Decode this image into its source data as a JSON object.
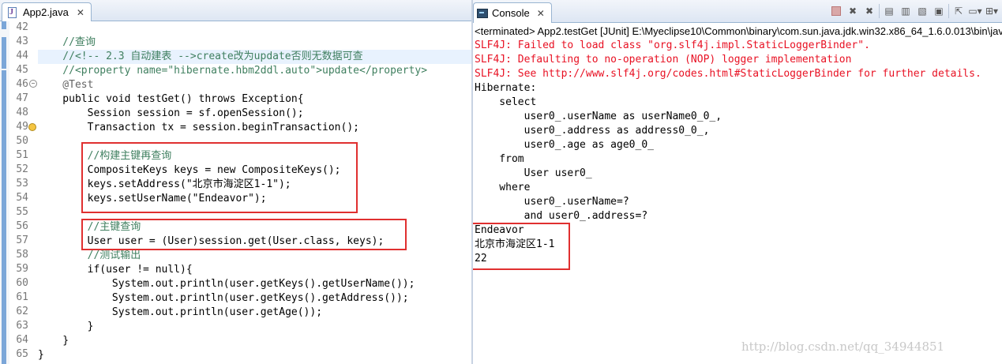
{
  "editor": {
    "tab_title": "App2.java",
    "close_glyph": "✕",
    "lines": [
      {
        "num": "42",
        "text": ""
      },
      {
        "num": "43",
        "text": "    //查询"
      },
      {
        "num": "44",
        "text": "    //<!-- 2.3 自动建表 -->create改为update否则无数据可查"
      },
      {
        "num": "45",
        "text": "    //<property name=\"hibernate.hbm2ddl.auto\">update</property>"
      },
      {
        "num": "46",
        "text": "    @Test"
      },
      {
        "num": "47",
        "text": "    public void testGet() throws Exception{"
      },
      {
        "num": "48",
        "text": "        Session session = sf.openSession();"
      },
      {
        "num": "49",
        "text": "        Transaction tx = session.beginTransaction();"
      },
      {
        "num": "50",
        "text": ""
      },
      {
        "num": "51",
        "text": "        //构建主键再查询"
      },
      {
        "num": "52",
        "text": "        CompositeKeys keys = new CompositeKeys();"
      },
      {
        "num": "53",
        "text": "        keys.setAddress(\"北京市海淀区1-1\");"
      },
      {
        "num": "54",
        "text": "        keys.setUserName(\"Endeavor\");"
      },
      {
        "num": "55",
        "text": ""
      },
      {
        "num": "56",
        "text": "        //主键查询"
      },
      {
        "num": "57",
        "text": "        User user = (User)session.get(User.class, keys);"
      },
      {
        "num": "58",
        "text": "        //测试输出"
      },
      {
        "num": "59",
        "text": "        if(user != null){"
      },
      {
        "num": "60",
        "text": "            System.out.println(user.getKeys().getUserName());"
      },
      {
        "num": "61",
        "text": "            System.out.println(user.getKeys().getAddress());"
      },
      {
        "num": "62",
        "text": "            System.out.println(user.getAge());"
      },
      {
        "num": "63",
        "text": "        }"
      },
      {
        "num": "64",
        "text": "    }"
      },
      {
        "num": "65",
        "text": "}"
      }
    ]
  },
  "console": {
    "tab_title": "Console",
    "close_glyph": "✕",
    "terminated_line": "<terminated> App2.testGet [JUnit] E:\\Myeclipse10\\Common\\binary\\com.sun.java.jdk.win32.x86_64_1.6.0.013\\bin\\javaw.exe",
    "toolbar_icons": [
      "terminate-icon",
      "remove-launch-icon",
      "remove-all-launches-icon",
      "clear-console-icon",
      "scroll-lock-icon",
      "word-wrap-icon",
      "show-console-icon",
      "pin-console-icon",
      "display-selected-console-icon",
      "open-console-icon"
    ],
    "output": [
      {
        "text": "SLF4J: Failed to load class \"org.slf4j.impl.StaticLoggerBinder\".",
        "color": "#e81123"
      },
      {
        "text": "SLF4J: Defaulting to no-operation (NOP) logger implementation",
        "color": "#e81123"
      },
      {
        "text": "SLF4J: See http://www.slf4j.org/codes.html#StaticLoggerBinder for further details.",
        "color": "#e81123"
      },
      {
        "text": "Hibernate: ",
        "color": "#000000"
      },
      {
        "text": "    select",
        "color": "#000000"
      },
      {
        "text": "        user0_.userName as userName0_0_,",
        "color": "#000000"
      },
      {
        "text": "        user0_.address as address0_0_,",
        "color": "#000000"
      },
      {
        "text": "        user0_.age as age0_0_ ",
        "color": "#000000"
      },
      {
        "text": "    from",
        "color": "#000000"
      },
      {
        "text": "        User user0_ ",
        "color": "#000000"
      },
      {
        "text": "    where",
        "color": "#000000"
      },
      {
        "text": "        user0_.userName=? ",
        "color": "#000000"
      },
      {
        "text": "        and user0_.address=?",
        "color": "#000000"
      },
      {
        "text": "Endeavor",
        "color": "#000000"
      },
      {
        "text": "北京市海淀区1-1",
        "color": "#000000"
      },
      {
        "text": "22",
        "color": "#000000"
      }
    ]
  },
  "watermark": "http://blog.csdn.net/qq_34944851",
  "colors": {
    "highlight_box": "#e03030",
    "error_text": "#e81123"
  }
}
